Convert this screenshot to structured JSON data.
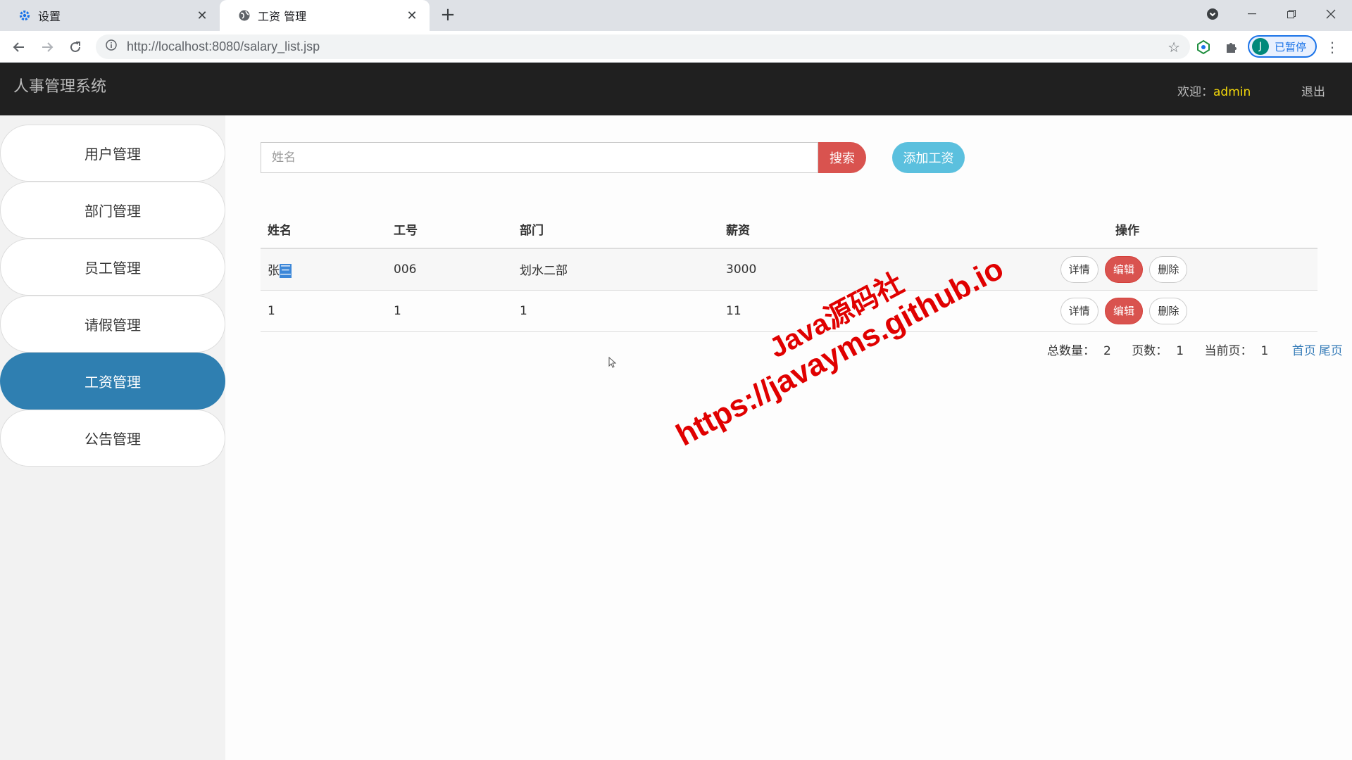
{
  "browser": {
    "tabs": [
      {
        "title": "设置",
        "icon": "gear-icon"
      },
      {
        "title": "工资 管理",
        "icon": "globe-icon"
      }
    ],
    "url_host": "http://localhost",
    "url_path": ":8080/salary_list.jsp",
    "profile_initial": "J",
    "profile_status": "已暂停"
  },
  "app": {
    "title": "人事管理系统",
    "welcome_label": "欢迎：",
    "username": "admin",
    "logout": "退出"
  },
  "sidebar": {
    "items": [
      {
        "label": "用户管理"
      },
      {
        "label": "部门管理"
      },
      {
        "label": "员工管理"
      },
      {
        "label": "请假管理"
      },
      {
        "label": "工资管理",
        "active": true
      },
      {
        "label": "公告管理"
      }
    ]
  },
  "search": {
    "placeholder": "姓名",
    "search_button": "搜索",
    "add_button": "添加工资"
  },
  "table": {
    "headers": {
      "name": "姓名",
      "emp_no": "工号",
      "dept": "部门",
      "salary": "薪资",
      "ops": "操作"
    },
    "rows": [
      {
        "name_a": "张",
        "name_b": "三",
        "emp_no": "006",
        "dept": "划水二部",
        "salary": "3000"
      },
      {
        "name_a": "1",
        "name_b": "",
        "emp_no": "1",
        "dept": "1",
        "salary": "11"
      }
    ],
    "actions": {
      "detail": "详情",
      "edit": "编辑",
      "delete": "删除"
    }
  },
  "pager": {
    "total_label": "总数量：",
    "total": "2",
    "pages_label": "页数：",
    "pages": "1",
    "current_label": "当前页：",
    "current": "1",
    "first": "首页",
    "last": "尾页"
  },
  "watermark": {
    "line1": "Java源码社",
    "line2": "https://javayms.github.io"
  },
  "colors": {
    "sidebar_active": "#2f7fb1",
    "danger": "#d9534f",
    "info": "#5bc0de",
    "header_bg": "#202020",
    "username": "#f5d90a",
    "watermark": "#e00000"
  }
}
